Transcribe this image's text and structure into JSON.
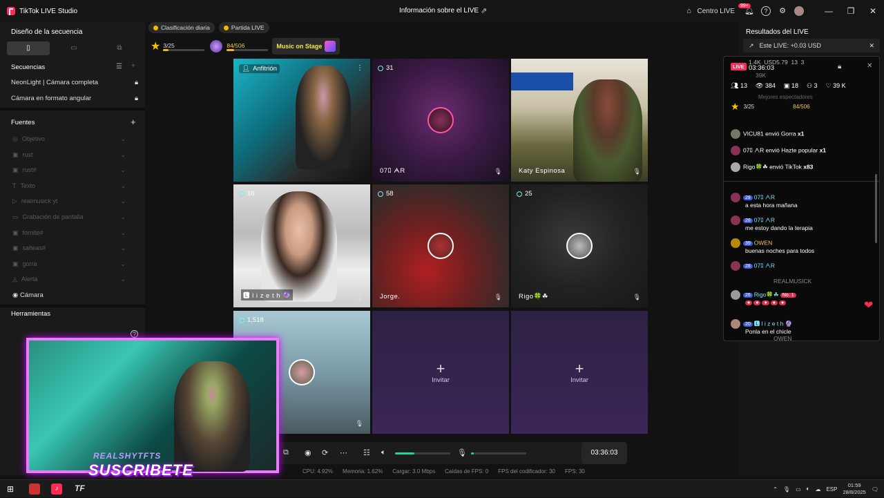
{
  "window": {
    "app_title": "TikTok LIVE Studio",
    "center_title": "Información sobre el LIVE",
    "centro_live": "Centro LIVE",
    "notif_badge": "99+"
  },
  "left": {
    "sequence_title": "Diseño de la secuencia",
    "sequences_label": "Secuencias",
    "scenes": [
      "NeonLight | Cámara completa",
      "Cámara en formato angular"
    ],
    "sources_label": "Fuentes",
    "sources": [
      "Objetivo",
      "rust",
      "rust#",
      "Texto",
      "realmusick yt",
      "Grabación de pantalla",
      "fornite#",
      "salteas#",
      "gorra",
      "Alerta"
    ],
    "camera_label": "Cámara",
    "tools_label": "Herramientas"
  },
  "gifts": {
    "daily": "Clasificación diaria",
    "match": "Partida LIVE",
    "progress1": "3/25",
    "progress2": "84/506",
    "music": "Music on Stage"
  },
  "grid": {
    "cells": [
      {
        "name": "",
        "viewers": "Anfitrión"
      },
      {
        "name": "07ﾛ ᗅR",
        "viewers": "31"
      },
      {
        "name": "Katy Espinosa",
        "viewers": ""
      },
      {
        "name": "🅻 l i z e t h 🔮",
        "viewers": "16"
      },
      {
        "name": "Jorge.",
        "viewers": "58"
      },
      {
        "name": "Rigo🍀☘",
        "viewers": "25"
      },
      {
        "name": "",
        "viewers": "1,518"
      }
    ],
    "invite_label": "Invitar"
  },
  "controls": {
    "timer": "03:36:03",
    "volume_pct": 35,
    "mic_pct": 5
  },
  "stats": [
    "CPU: 4.92%",
    "Memoria: 1.62%",
    "Cargar: 3.0 Mbps",
    "Caídas de FPS: 0",
    "FPS del codificador: 30",
    "FPS: 30"
  ],
  "right": {
    "title": "Resultados del LIVE",
    "este_live": "Este LIVE: +0.03 USD",
    "overlay": {
      "live_badge": "LIVE",
      "time": "03:36:03",
      "top_stats": [
        "1.4K",
        "USD5.79",
        "13",
        "3"
      ],
      "likes_small": "39K",
      "stats": [
        "13",
        "384",
        "18",
        "3",
        "39 K"
      ],
      "best_label": "Mejores espectadores",
      "star_progress": "3/25",
      "gift_progress": "84/506",
      "gifts": [
        {
          "user": "VICU81",
          "text": "envió Gorra",
          "count": "x1"
        },
        {
          "user": "07ﾛ ᗅR",
          "text": "envió Hazte popular",
          "count": "x1"
        },
        {
          "user": "Rigo🍀☘",
          "text": "envió TikTok",
          "count": "x83"
        }
      ],
      "chat": [
        {
          "lvl": "28",
          "user": "07ﾛ ᗅR",
          "msg": "a esta hora mañana"
        },
        {
          "lvl": "28",
          "user": "07ﾛ ᗅR",
          "msg": "me estoy dando la terapia"
        },
        {
          "lvl": "39",
          "user": "OWEN",
          "msg": "buenas noches para todos"
        },
        {
          "lvl": "28",
          "user": "07ﾛ ᗅR",
          "msg": ""
        },
        {
          "lvl": "",
          "user": "REALMUSICK",
          "msg": ""
        },
        {
          "lvl": "26",
          "user": "Rigo🍀☘",
          "msg": "No. 1"
        },
        {
          "lvl": "20",
          "user": "🅻 l i z e t h 🔮",
          "msg": "Ponla en el chicle"
        }
      ],
      "bottom_user": "OWEN"
    }
  },
  "overlay_cam": {
    "small": "REALSHYTFTS",
    "big": "SUSCRIBETE"
  },
  "taskbar": {
    "lang": "ESP",
    "time": "01:59",
    "date": "28/8/2025"
  }
}
